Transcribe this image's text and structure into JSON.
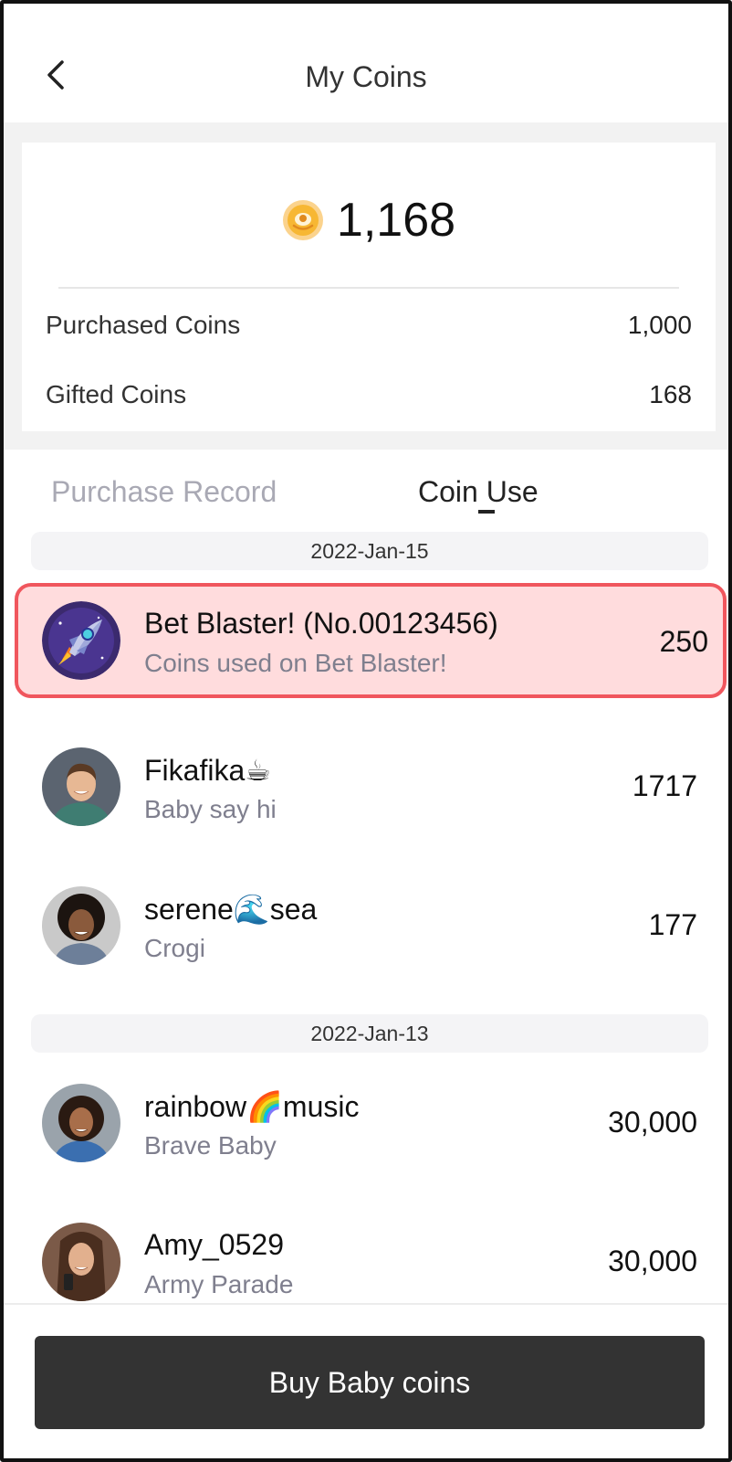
{
  "header": {
    "title": "My Coins"
  },
  "balance": {
    "total": "1,168",
    "purchased_label": "Purchased Coins",
    "purchased_value": "1,000",
    "gifted_label": "Gifted Coins",
    "gifted_value": "168"
  },
  "tabs": {
    "purchase_record": "Purchase Record",
    "coin_use": "Coin Use",
    "active": "coin_use"
  },
  "groups": [
    {
      "date": "2022-Jan-15",
      "records": [
        {
          "name": "Bet Blaster! (No.00123456)",
          "desc": "Coins used on Bet Blaster!",
          "amount": "250",
          "highlighted": true,
          "avatar_icon": "rocket-icon"
        },
        {
          "name": "Fikafika☕",
          "desc": "Baby say hi",
          "amount": "1717",
          "avatar_icon": "user-photo"
        },
        {
          "name": "serene🌊sea",
          "desc": "Crogi",
          "amount": "177",
          "avatar_icon": "user-photo"
        }
      ]
    },
    {
      "date": "2022-Jan-13",
      "records": [
        {
          "name": "rainbow🌈music",
          "desc": "Brave Baby",
          "amount": "30,000",
          "avatar_icon": "user-photo"
        },
        {
          "name": "Amy_0529",
          "desc": "Army Parade",
          "amount": "30,000",
          "avatar_icon": "user-photo"
        }
      ]
    }
  ],
  "footer": {
    "buy_label": "Buy Baby coins"
  },
  "colors": {
    "highlight_bg": "#ffdcdd",
    "highlight_border": "#f0565d",
    "coin": "#f7b733",
    "button": "#333333"
  }
}
